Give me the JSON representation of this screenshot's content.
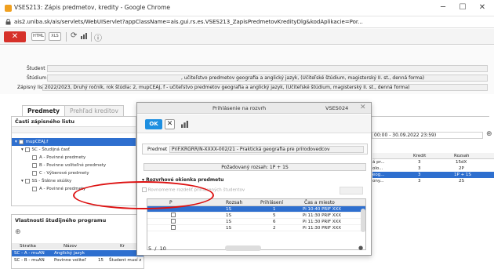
{
  "browser": {
    "title": "VSES213: Zápis predmetov, kredity - Google Chrome",
    "url": "ais2.uniba.sk/ais/servlets/WebUIServlet?appClassName=ais.gui.rs.es.VSES213_ZapisPredmetovKredityDlg&kodAplikacie=Por..."
  },
  "toolbar": {
    "close_symbol": "✕",
    "btn1": "HTML",
    "btn2": "XLS",
    "icon_glyph": "⟳",
    "info_glyph": "ⓘ"
  },
  "info": {
    "student_label": "Študent",
    "studium_label": "Štúdium",
    "studium_value": ", učiteľstvo predmetov geografia a anglický jazyk, (Učiteľské štúdium, magisterský II. st., denná forma)",
    "zapisny_label": "Zápisný list",
    "zapisny_value": "2022/2023, Druhý ročník, rok štúdia: 2, mupCEAJ, f - učiteľstvo predmetov geografia a anglický jazyk, (Učiteľské štúdium, magisterský II. st., denná forma)"
  },
  "tabs": {
    "predmety": "Predmety",
    "prehlad": "Prehľad kreditov"
  },
  "tree": {
    "header": "Časti zápisného listu",
    "items": [
      "mupCEAJ,f",
      "SC - Študijná časť",
      "A - Povinné predmety",
      "B - Povinne voliteľné predmety",
      "C - Výberové predmety",
      "SS - Štátne skúšky",
      "A - Povinné predmety"
    ]
  },
  "bottom": {
    "header": "Vlastnosti študijného programu",
    "cols": [
      "Skratka",
      "Názov",
      "Kr"
    ],
    "rows": [
      [
        "SC - A - muAN",
        "Anglický jazyk",
        ""
      ],
      [
        "SC - B - muAN",
        "Povinne voliteľ",
        "15",
        "Študent musí z"
      ]
    ]
  },
  "righttable": {
    "date": "00:00 - 30.09.2022 23:59)",
    "cols": [
      "Kredit",
      "Rozsah"
    ],
    "rows": [
      [
        "á pr...",
        "3",
        "15dX"
      ],
      [
        "olo...",
        "3",
        "2P"
      ],
      [
        "eog...",
        "3",
        "1P + 1S"
      ],
      [
        "ony...",
        "3",
        "2S"
      ]
    ]
  },
  "dialog": {
    "title": "Prihlásenie na rozvrh",
    "code": "VSES024",
    "ok": "OK",
    "predmet_label": "Predmet",
    "predmet_value": "PriF.KRGRR/N-XXXX-002/21 - Praktická geografia pre prírodovedcov",
    "rozsah": "Požadovaný rozsah: 1P + 1S",
    "section": "Rozvrhové okienka predmetu",
    "checkbox_label": "Rovnomerne rozdeliť prihlásených študentov",
    "cols": [
      "P",
      "Rozsah",
      "Prihlásení",
      "Čas a miesto"
    ],
    "rows": [
      {
        "rozsah": "1S",
        "prihl": "1",
        "cas": "Pi 10:40 PRIF XXX"
      },
      {
        "rozsah": "1S",
        "prihl": "5",
        "cas": "Pi 11:30 PRIF XXX"
      },
      {
        "rozsah": "1S",
        "prihl": "6",
        "cas": "Pi 11:30 PRIF XXX"
      },
      {
        "rozsah": "1S",
        "prihl": "2",
        "cas": "Pi 11:30 PRIF XXX"
      }
    ],
    "pager_current": "5",
    "pager_total": "10"
  }
}
